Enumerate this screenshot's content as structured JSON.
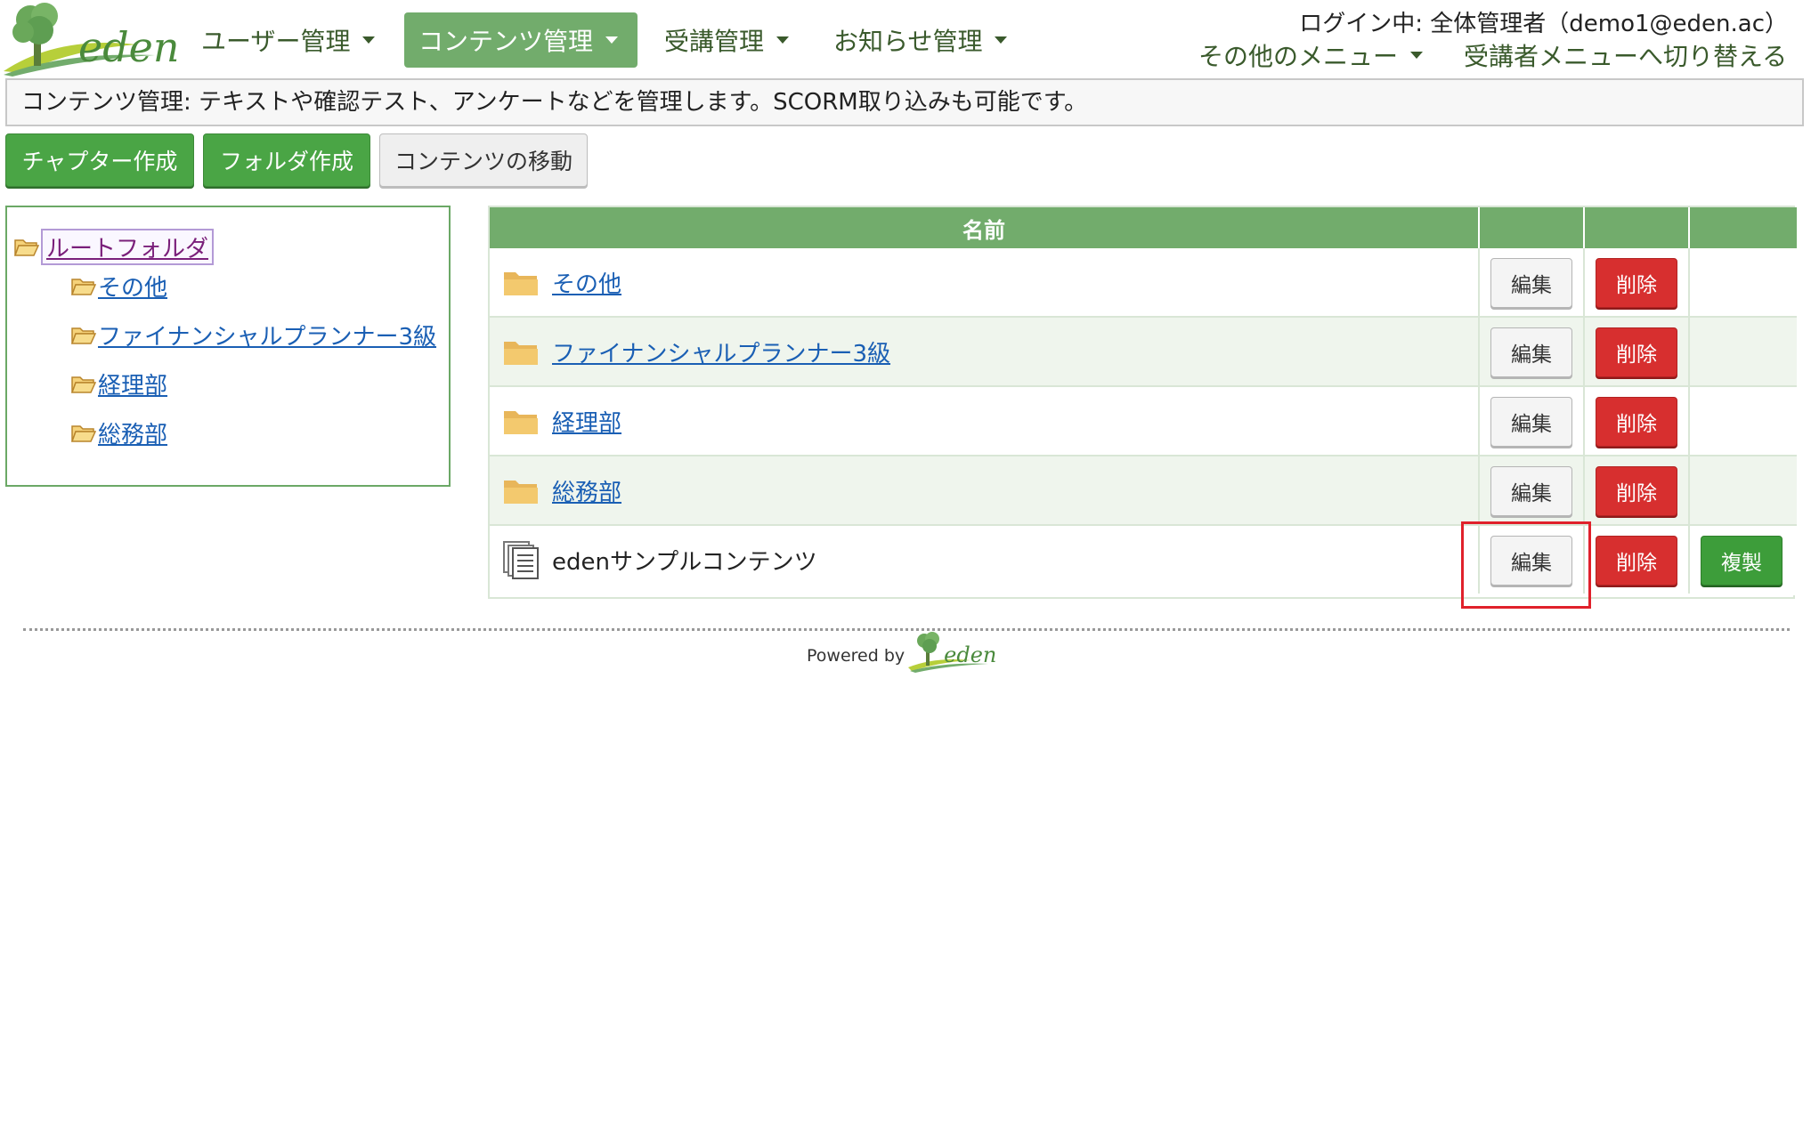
{
  "header": {
    "logo_text": "eden",
    "nav": [
      {
        "label": "ユーザー管理",
        "active": false
      },
      {
        "label": "コンテンツ管理",
        "active": true
      },
      {
        "label": "受講管理",
        "active": false
      },
      {
        "label": "お知らせ管理",
        "active": false
      }
    ],
    "login_status": "ログイン中: 全体管理者（demo1@eden.ac）",
    "other_menu": "その他のメニュー",
    "switch_menu": "受講者メニューへ切り替える"
  },
  "info_bar": "コンテンツ管理: テキストや確認テスト、アンケートなどを管理します。SCORM取り込みも可能です。",
  "actions": {
    "create_chapter": "チャプター作成",
    "create_folder": "フォルダ作成",
    "move_content": "コンテンツの移動"
  },
  "tree": {
    "root": "ルートフォルダ",
    "children": [
      "その他",
      "ファイナンシャルプランナー3級",
      "経理部",
      "総務部"
    ]
  },
  "table": {
    "header_name": "名前",
    "edit_label": "編集",
    "delete_label": "削除",
    "copy_label": "複製",
    "rows": [
      {
        "name": "その他",
        "type": "folder"
      },
      {
        "name": "ファイナンシャルプランナー3級",
        "type": "folder"
      },
      {
        "name": "経理部",
        "type": "folder"
      },
      {
        "name": "総務部",
        "type": "folder"
      },
      {
        "name": "edenサンプルコンテンツ",
        "type": "content"
      }
    ]
  },
  "footer": {
    "powered_by": "Powered by",
    "logo_text": "eden"
  },
  "colors": {
    "brand_green": "#72ac6c",
    "button_green": "#4aa545",
    "delete_red": "#d72f2f",
    "highlight_red": "#e0212b",
    "link_blue": "#1a5fb4"
  }
}
